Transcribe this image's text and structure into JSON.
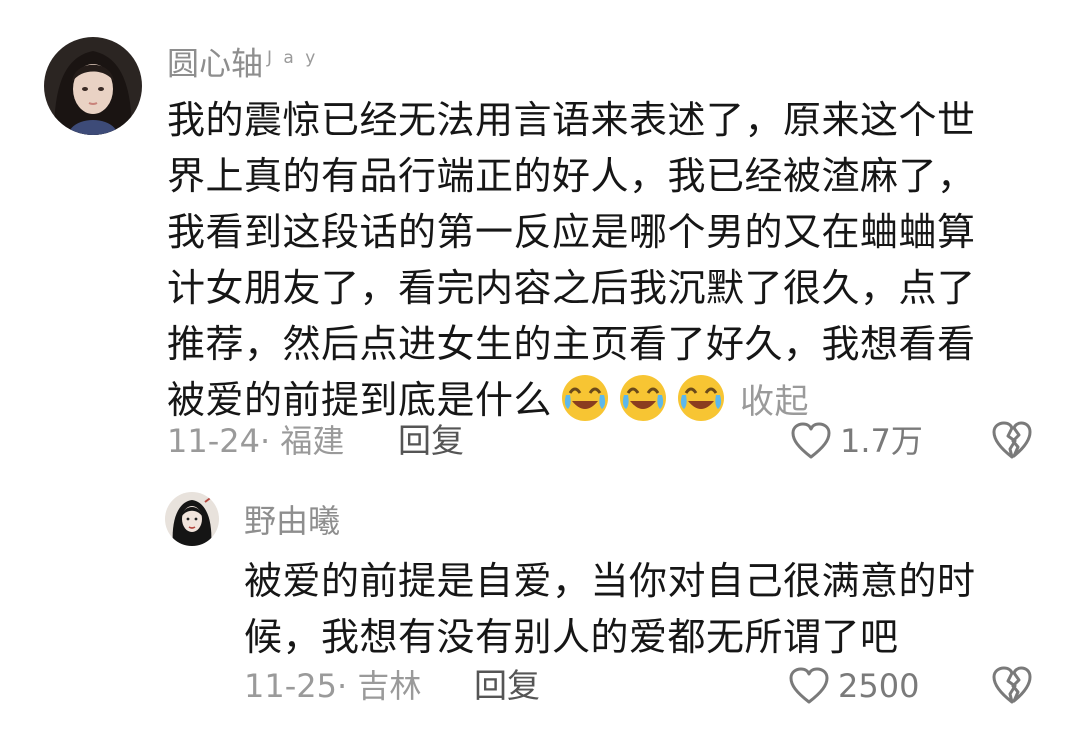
{
  "comment": {
    "username": "圆心轴",
    "username_tag": "J a y",
    "text_lines": [
      "我的震惊已经无法用言语来表述了，原来这个世",
      "界上真的有品行端正的好人，我已经被渣麻了，",
      "我看到这段话的第一反应是哪个男的又在蛐蛐算",
      "计女朋友了，看完内容之后我沉默了很久，点了",
      "推荐，然后点进女生的主页看了好久，我想看看",
      "被爱的前提到底是什么"
    ],
    "emojis": [
      "crying-laugh-emoji",
      "crying-laugh-emoji",
      "crying-laugh-emoji"
    ],
    "collapse_label": "收起",
    "date": "11-24",
    "location": "福建",
    "meta_separator": "· ",
    "reply_label": "回复",
    "like_count": "1.7万",
    "like_icon": "heart-outline-icon",
    "dislike_icon": "broken-heart-icon"
  },
  "reply": {
    "username": "野由曦",
    "text_lines": [
      "被爱的前提是自爱，当你对自己很满意的时",
      "候，我想有没有别人的爱都无所谓了吧"
    ],
    "date": "11-25",
    "location": "吉林",
    "meta_separator": "· ",
    "reply_label": "回复",
    "like_count": "2500",
    "like_icon": "heart-outline-icon",
    "dislike_icon": "broken-heart-icon"
  },
  "colors": {
    "text_primary": "#161616",
    "text_secondary": "#9a9a9a",
    "icon_gray": "#7a7a7a",
    "emoji_yellow": "#f7c533"
  }
}
